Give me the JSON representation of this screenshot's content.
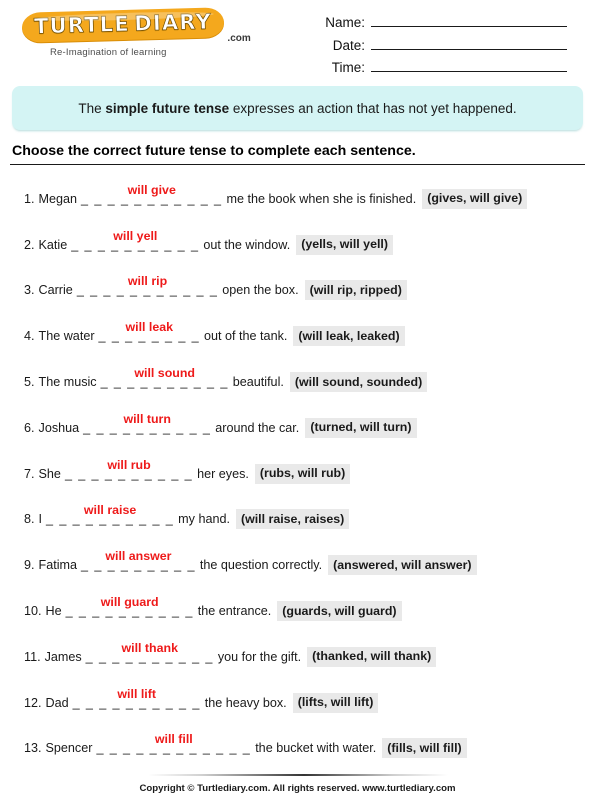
{
  "brand": {
    "logo_word_1": "TURTLE",
    "logo_word_2": "DIARY",
    "logo_suffix": ".com",
    "tagline": "Re-Imagination of learning"
  },
  "header": {
    "fields": [
      {
        "label": "Name:"
      },
      {
        "label": "Date:"
      },
      {
        "label": "Time:"
      }
    ]
  },
  "banner": {
    "prefix": "The ",
    "highlight": "simple future tense",
    "suffix": " expresses an action that has not yet happened."
  },
  "instruction": "Choose the correct future tense to complete each sentence.",
  "questions": [
    {
      "num": "1.",
      "pre": "Megan",
      "dashes": "_ _ _ _ _ _ _ _ _ _ _",
      "answer": "will give",
      "post": "me the book when she is finished.",
      "options": "(gives, will give)"
    },
    {
      "num": "2.",
      "pre": "Katie",
      "dashes": "_ _ _ _ _ _ _ _ _ _",
      "answer": "will yell",
      "post": "out the window.",
      "options": "(yells, will yell)"
    },
    {
      "num": "3.",
      "pre": "Carrie",
      "dashes": "_ _ _ _ _ _ _ _ _ _ _",
      "answer": "will rip",
      "post": "open the box.",
      "options": "(will rip, ripped)"
    },
    {
      "num": "4.",
      "pre": "The water",
      "dashes": "_ _ _ _ _ _ _ _",
      "answer": "will leak",
      "post": "out of the tank.",
      "options": "(will leak, leaked)"
    },
    {
      "num": "5.",
      "pre": "The music",
      "dashes": "_ _ _ _ _ _ _ _ _ _",
      "answer": "will sound",
      "post": "beautiful.",
      "options": "(will sound, sounded)"
    },
    {
      "num": "6.",
      "pre": "Joshua",
      "dashes": "_ _ _ _ _ _ _ _ _ _",
      "answer": "will turn",
      "post": "around the car.",
      "options": "(turned, will turn)"
    },
    {
      "num": "7.",
      "pre": "She",
      "dashes": "_ _ _ _ _ _ _ _ _ _",
      "answer": "will rub",
      "post": "her eyes.",
      "options": "(rubs, will rub)"
    },
    {
      "num": "8.",
      "pre": "I",
      "dashes": "_ _ _ _ _ _ _ _ _ _",
      "answer": "will raise",
      "post": "my hand.",
      "options": "(will raise, raises)"
    },
    {
      "num": "9.",
      "pre": "Fatima",
      "dashes": "_ _ _ _ _ _ _ _ _",
      "answer": "will answer",
      "post": "the question correctly.",
      "options": "(answered, will answer)"
    },
    {
      "num": "10.",
      "pre": "He",
      "dashes": "_ _ _ _ _ _ _ _ _ _",
      "answer": "will guard",
      "post": "the entrance.",
      "options": "(guards, will guard)"
    },
    {
      "num": "11.",
      "pre": "James",
      "dashes": "_ _ _ _ _ _ _ _ _ _",
      "answer": "will thank",
      "post": "you for the gift.",
      "options": "(thanked, will thank)"
    },
    {
      "num": "12.",
      "pre": "Dad",
      "dashes": "_ _ _ _ _ _ _ _ _ _",
      "answer": "will lift",
      "post": "the heavy box.",
      "options": "(lifts, will lift)"
    },
    {
      "num": "13.",
      "pre": "Spencer",
      "dashes": "_ _ _ _ _ _ _ _ _ _ _ _",
      "answer": "will fill",
      "post": "the bucket with water.",
      "options": "(fills, will fill)"
    }
  ],
  "footer": {
    "text": "Copyright © Turtlediary.com. All rights reserved. www.turtlediary.com"
  },
  "colors": {
    "answer_red": "#ee1a1a",
    "banner_bg": "#d4f4f4",
    "options_bg": "#e9e9e9",
    "logo_gold": "#f4a81d"
  }
}
